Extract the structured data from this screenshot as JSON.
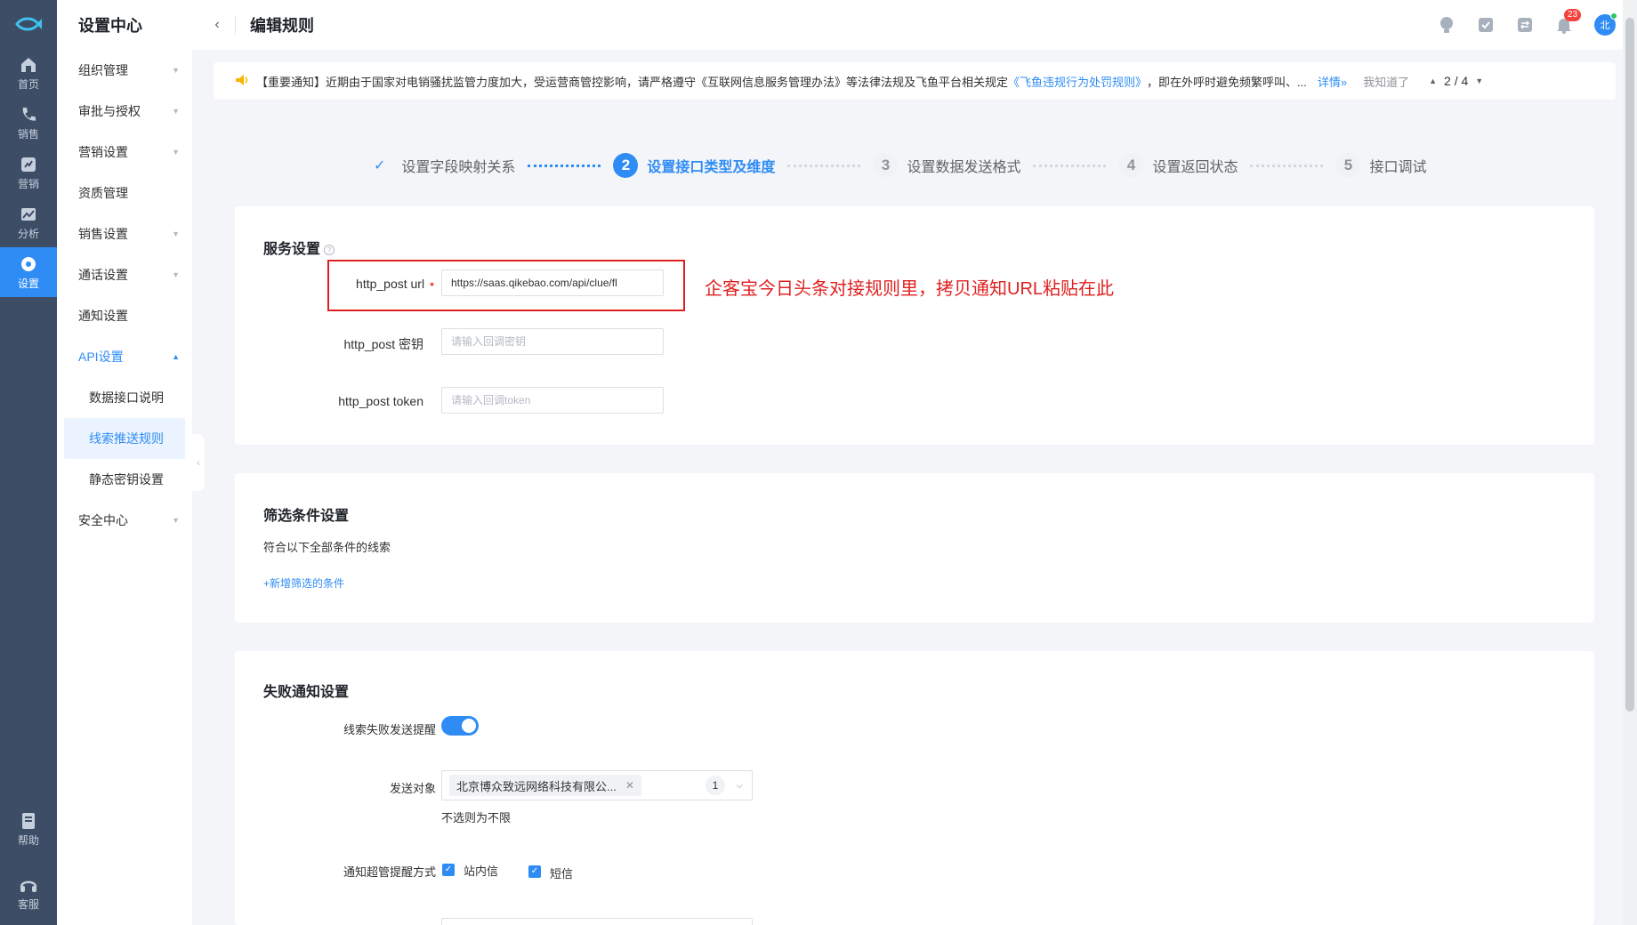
{
  "rail": {
    "items": [
      {
        "label": "首页",
        "icon": "home-icon"
      },
      {
        "label": "销售",
        "icon": "phone-icon"
      },
      {
        "label": "营销",
        "icon": "marketing-icon"
      },
      {
        "label": "分析",
        "icon": "chart-icon"
      },
      {
        "label": "设置",
        "icon": "settings-icon",
        "active": true
      }
    ],
    "bottom": [
      {
        "label": "帮助",
        "icon": "help-book-icon"
      },
      {
        "label": "客服",
        "icon": "headset-icon"
      }
    ]
  },
  "submenu": {
    "title": "设置中心",
    "items": [
      {
        "label": "组织管理"
      },
      {
        "label": "审批与授权"
      },
      {
        "label": "营销设置"
      },
      {
        "label": "资质管理"
      },
      {
        "label": "销售设置"
      },
      {
        "label": "通话设置"
      },
      {
        "label": "通知设置"
      },
      {
        "label": "API设置"
      },
      {
        "label": "数据接口说明"
      },
      {
        "label": "线索推送规则"
      },
      {
        "label": "静态密钥设置"
      },
      {
        "label": "安全中心"
      }
    ]
  },
  "header": {
    "title": "编辑规则",
    "notification_count": "23",
    "avatar_text": "北"
  },
  "notice": {
    "text_before": "【重要通知】近期由于国家对电销骚扰监管力度加大，受运营商管控影响，请严格遵守《互联网信息服务管理办法》等法律法规及飞鱼平台相关规定",
    "link": "《飞鱼违规行为处罚规则》",
    "text_after": "，即在外呼时避免频繁呼叫、...",
    "more": "详情»",
    "dismiss": "我知道了",
    "pager": "2 / 4"
  },
  "steps": {
    "s1": "设置字段映射关系",
    "s2_num": "2",
    "s2": "设置接口类型及维度",
    "s3_num": "3",
    "s3": "设置数据发送格式",
    "s4_num": "4",
    "s4": "设置返回状态",
    "s5_num": "5",
    "s5": "接口调试"
  },
  "service": {
    "title": "服务设置",
    "url_label": "http_post url",
    "url_value": "https://saas.qikebao.com/api/clue/fl",
    "secret_label": "http_post 密钥",
    "secret_placeholder": "请输入回调密钥",
    "token_label": "http_post token",
    "token_placeholder": "请输入回调token",
    "annotation": "企客宝今日头条对接规则里，拷贝通知URL粘贴在此"
  },
  "filter": {
    "title": "筛选条件设置",
    "desc": "符合以下全部条件的线索",
    "add": "+新增筛选的条件"
  },
  "failure": {
    "title": "失败通知设置",
    "reminder_label": "线索失败发送提醒",
    "reminder_on": true,
    "target_label": "发送对象",
    "target_tag": "北京博众致远网络科技有限公...",
    "target_count": "1",
    "target_hint": "不选则为不限",
    "method_label": "通知超管提醒方式",
    "method_1": "站内信",
    "method_2": "短信"
  }
}
